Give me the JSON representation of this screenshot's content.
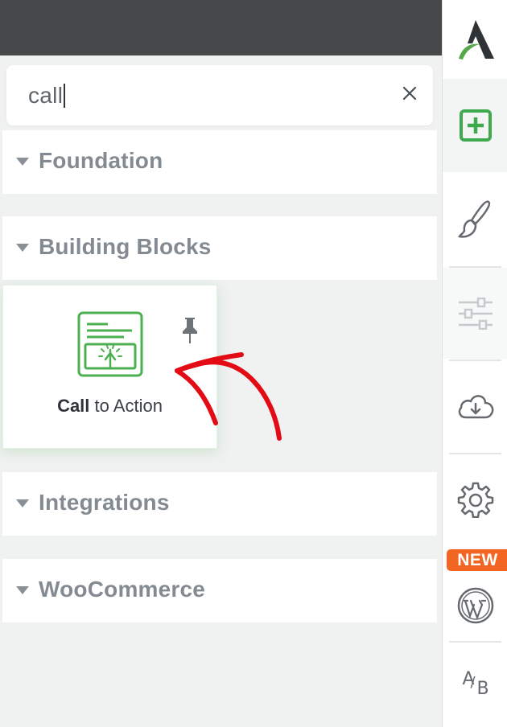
{
  "search": {
    "value": "call"
  },
  "sections": [
    {
      "label": "Foundation"
    },
    {
      "label": "Building Blocks"
    },
    {
      "label": "Integrations"
    },
    {
      "label": "WooCommerce"
    }
  ],
  "card": {
    "label_bold": "Call",
    "label_rest": " to Action"
  },
  "sidebar": {
    "new_badge": "NEW"
  },
  "colors": {
    "accent_green": "#4caf50",
    "badge_orange": "#f26522",
    "arrow_red": "#e30b14"
  }
}
